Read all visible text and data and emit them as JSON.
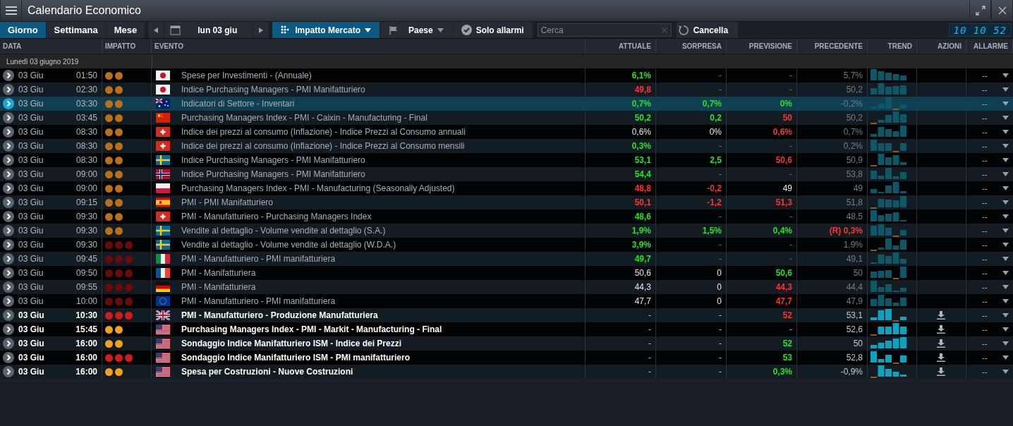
{
  "window": {
    "title": "Calendario Economico"
  },
  "tabs": [
    {
      "label": "Giorno",
      "selected": true
    },
    {
      "label": "Settimana",
      "selected": false
    },
    {
      "label": "Mese",
      "selected": false
    }
  ],
  "date_picker": {
    "value": "lun 03 giu"
  },
  "filters": [
    {
      "kind": "impact",
      "label": "Impatto Mercato",
      "active": true
    },
    {
      "kind": "country",
      "label": "Paese",
      "active": false
    },
    {
      "kind": "alarms",
      "label": "Solo allarmi",
      "active": false
    }
  ],
  "search": {
    "placeholder": "Cerca"
  },
  "reset_button": {
    "label": "Cancella"
  },
  "clock": "10 10 52",
  "columns": [
    "DATA",
    "IMPATTO",
    "EVENTO",
    "ATTUALE",
    "SORPRESA",
    "PREVISIONE",
    "PRECEDENTE",
    "TREND",
    "AZIONI",
    "ALLARME"
  ],
  "group": {
    "label": "Lunedì 03 giugno 2019"
  },
  "rows": [
    {
      "date": "03 Giu",
      "time": "01:50",
      "impact": [
        {
          "color": "#b8701a"
        },
        {
          "color": "#b8701a"
        }
      ],
      "released": true,
      "selected": false,
      "flag": {
        "kind": "jp"
      },
      "event": "Spese per Investimenti - (Annuale)",
      "actual": {
        "text": "6,1%",
        "color": "#22e622",
        "dimmed": false
      },
      "surprise": {
        "text": "-",
        "dimmed": true
      },
      "forecast": {
        "text": "-",
        "dimmed": true
      },
      "previous": {
        "text": "5,7%",
        "dimmed": true
      },
      "alarm": "--"
    },
    {
      "date": "03 Giu",
      "time": "02:30",
      "impact": [
        {
          "color": "#b8701a"
        },
        {
          "color": "#b8701a"
        }
      ],
      "released": true,
      "selected": false,
      "flag": {
        "kind": "jp"
      },
      "event": "Indice Purchasing Managers - PMI Manifatturiero",
      "actual": {
        "text": "49,8",
        "color": "#ff3333",
        "dimmed": false
      },
      "surprise": {
        "text": "-",
        "dimmed": true
      },
      "forecast": {
        "text": "-",
        "dimmed": true
      },
      "previous": {
        "text": "50,2",
        "dimmed": true
      },
      "alarm": "--"
    },
    {
      "date": "03 Giu",
      "time": "03:30",
      "impact": [
        {
          "color": "#b8701a"
        },
        {
          "color": "#b8701a"
        }
      ],
      "released": true,
      "selected": true,
      "flag": {
        "kind": "au"
      },
      "event": "Indicatori di Settore - Inventari",
      "actual": {
        "text": "0,7%",
        "color": "#22e622",
        "dimmed": false
      },
      "surprise": {
        "text": "0,7%",
        "color": "#22e622",
        "dimmed": false
      },
      "forecast": {
        "text": "0%",
        "color": "#22e622",
        "dimmed": false
      },
      "previous": {
        "text": "-0,2%",
        "dimmed": true
      },
      "alarm": "--"
    },
    {
      "date": "03 Giu",
      "time": "03:45",
      "impact": [
        {
          "color": "#b8701a"
        },
        {
          "color": "#b8701a"
        }
      ],
      "released": true,
      "selected": false,
      "flag": {
        "kind": "cn"
      },
      "event": "Purchasing Managers Index - PMI - Caixin - Manufacturing - Final",
      "actual": {
        "text": "50,2",
        "color": "#22e622",
        "dimmed": false
      },
      "surprise": {
        "text": "0,2",
        "color": "#22e622",
        "dimmed": false
      },
      "forecast": {
        "text": "50",
        "color": "#ff3333",
        "dimmed": false
      },
      "previous": {
        "text": "50,2",
        "dimmed": true
      },
      "alarm": "--"
    },
    {
      "date": "03 Giu",
      "time": "08:30",
      "impact": [
        {
          "color": "#b8701a"
        },
        {
          "color": "#b8701a"
        }
      ],
      "released": true,
      "selected": false,
      "flag": {
        "kind": "ch"
      },
      "event": "Indice dei prezzi al consumo (Inflazione) - Indice Prezzi al Consumo annuali",
      "actual": {
        "text": "0,6%",
        "dimmed": false
      },
      "surprise": {
        "text": "0%",
        "dimmed": false
      },
      "forecast": {
        "text": "0,6%",
        "color": "#ff3333",
        "dimmed": false
      },
      "previous": {
        "text": "0,7%",
        "dimmed": true
      },
      "alarm": "--"
    },
    {
      "date": "03 Giu",
      "time": "08:30",
      "impact": [
        {
          "color": "#b8701a"
        },
        {
          "color": "#b8701a"
        }
      ],
      "released": true,
      "selected": false,
      "flag": {
        "kind": "ch"
      },
      "event": "Indice dei prezzi al consumo (Inflazione) - Indice Prezzi al Consumo mensili",
      "actual": {
        "text": "0,3%",
        "color": "#22e622",
        "dimmed": false
      },
      "surprise": {
        "text": "-",
        "dimmed": true
      },
      "forecast": {
        "text": "-",
        "dimmed": true
      },
      "previous": {
        "text": "0,2%",
        "dimmed": true
      },
      "alarm": "--"
    },
    {
      "date": "03 Giu",
      "time": "08:30",
      "impact": [
        {
          "color": "#b8701a"
        },
        {
          "color": "#b8701a"
        }
      ],
      "released": true,
      "selected": false,
      "flag": {
        "kind": "se"
      },
      "event": "Indice Purchasing Managers - PMI Manifatturiero",
      "actual": {
        "text": "53,1",
        "color": "#22e622",
        "dimmed": false
      },
      "surprise": {
        "text": "2,5",
        "color": "#22e622",
        "dimmed": false
      },
      "forecast": {
        "text": "50,6",
        "color": "#ff3333",
        "dimmed": false
      },
      "previous": {
        "text": "50,9",
        "dimmed": true
      },
      "alarm": "--"
    },
    {
      "date": "03 Giu",
      "time": "09:00",
      "impact": [
        {
          "color": "#b8701a"
        },
        {
          "color": "#b8701a"
        }
      ],
      "released": true,
      "selected": false,
      "flag": {
        "kind": "no"
      },
      "event": "Indice Purchasing Managers - PMI Manifatturiero",
      "actual": {
        "text": "54,4",
        "color": "#22e622",
        "dimmed": false
      },
      "surprise": {
        "text": "-",
        "dimmed": true
      },
      "forecast": {
        "text": "-",
        "dimmed": true
      },
      "previous": {
        "text": "53,8",
        "dimmed": true
      },
      "alarm": "--"
    },
    {
      "date": "03 Giu",
      "time": "09:00",
      "impact": [
        {
          "color": "#b8701a"
        },
        {
          "color": "#b8701a"
        }
      ],
      "released": true,
      "selected": false,
      "flag": {
        "kind": "pl"
      },
      "event": "Purchasing Managers Index - PMI - Manufacturing (Seasonally Adjusted)",
      "actual": {
        "text": "48,8",
        "color": "#ff3333",
        "dimmed": false
      },
      "surprise": {
        "text": "-0,2",
        "color": "#ff3333",
        "dimmed": false
      },
      "forecast": {
        "text": "49",
        "dimmed": false
      },
      "previous": {
        "text": "49",
        "dimmed": true
      },
      "alarm": "--"
    },
    {
      "date": "03 Giu",
      "time": "09:15",
      "impact": [
        {
          "color": "#b8701a"
        },
        {
          "color": "#b8701a"
        }
      ],
      "released": true,
      "selected": false,
      "flag": {
        "kind": "es"
      },
      "event": "PMI - PMI Manifatturiero",
      "actual": {
        "text": "50,1",
        "color": "#ff3333",
        "dimmed": false
      },
      "surprise": {
        "text": "-1,2",
        "color": "#ff3333",
        "dimmed": false
      },
      "forecast": {
        "text": "51,3",
        "color": "#ff3333",
        "dimmed": false
      },
      "previous": {
        "text": "51,8",
        "dimmed": true
      },
      "alarm": "--"
    },
    {
      "date": "03 Giu",
      "time": "09:30",
      "impact": [
        {
          "color": "#b8701a"
        },
        {
          "color": "#b8701a"
        }
      ],
      "released": true,
      "selected": false,
      "flag": {
        "kind": "ch"
      },
      "event": "PMI - Manufatturiero - Purchasing Managers Index",
      "actual": {
        "text": "48,6",
        "color": "#22e622",
        "dimmed": false
      },
      "surprise": {
        "text": "-",
        "dimmed": true
      },
      "forecast": {
        "text": "-",
        "dimmed": true
      },
      "previous": {
        "text": "48,5",
        "dimmed": true
      },
      "alarm": "--"
    },
    {
      "date": "03 Giu",
      "time": "09:30",
      "impact": [
        {
          "color": "#b8701a"
        },
        {
          "color": "#b8701a"
        }
      ],
      "released": true,
      "selected": false,
      "flag": {
        "kind": "se"
      },
      "event": "Vendite al dettaglio - Volume vendite al dettaglio (S.A.)",
      "actual": {
        "text": "1,9%",
        "color": "#22e622",
        "dimmed": false
      },
      "surprise": {
        "text": "1,5%",
        "color": "#22e622",
        "dimmed": false
      },
      "forecast": {
        "text": "0,4%",
        "color": "#22e622",
        "dimmed": false
      },
      "previous": {
        "text": "(R) 0,3%",
        "color": "#ff3333",
        "dimmed": false
      },
      "alarm": "--"
    },
    {
      "date": "03 Giu",
      "time": "09:30",
      "impact": [
        {
          "color": "#6a0c0c"
        },
        {
          "color": "#6a0c0c"
        },
        {
          "color": "#6a0c0c"
        }
      ],
      "released": true,
      "selected": false,
      "flag": {
        "kind": "se"
      },
      "event": "Vendite al dettaglio - Volume vendite al dettaglio (W.D.A.)",
      "actual": {
        "text": "3,9%",
        "color": "#22e622",
        "dimmed": false
      },
      "surprise": {
        "text": "-",
        "dimmed": true
      },
      "forecast": {
        "text": "-",
        "dimmed": true
      },
      "previous": {
        "text": "1,9%",
        "dimmed": true
      },
      "alarm": "--"
    },
    {
      "date": "03 Giu",
      "time": "09:45",
      "impact": [
        {
          "color": "#6a0c0c"
        },
        {
          "color": "#6a0c0c"
        },
        {
          "color": "#6a0c0c"
        }
      ],
      "released": true,
      "selected": false,
      "flag": {
        "kind": "it"
      },
      "event": "PMI - Manufatturiero - PMI manifatturiera",
      "actual": {
        "text": "49,7",
        "color": "#22e622",
        "dimmed": false
      },
      "surprise": {
        "text": "-",
        "dimmed": true
      },
      "forecast": {
        "text": "-",
        "dimmed": true
      },
      "previous": {
        "text": "49,1",
        "dimmed": true
      },
      "alarm": "--"
    },
    {
      "date": "03 Giu",
      "time": "09:50",
      "impact": [
        {
          "color": "#6a0c0c"
        },
        {
          "color": "#6a0c0c"
        },
        {
          "color": "#6a0c0c"
        }
      ],
      "released": true,
      "selected": false,
      "flag": {
        "kind": "fr"
      },
      "event": "PMI - Manifatturiera",
      "actual": {
        "text": "50,6",
        "dimmed": false
      },
      "surprise": {
        "text": "0",
        "dimmed": false
      },
      "forecast": {
        "text": "50,6",
        "color": "#22e622",
        "dimmed": false
      },
      "previous": {
        "text": "50",
        "dimmed": true
      },
      "alarm": "--"
    },
    {
      "date": "03 Giu",
      "time": "09:55",
      "impact": [
        {
          "color": "#6a0c0c"
        },
        {
          "color": "#6a0c0c"
        },
        {
          "color": "#6a0c0c"
        }
      ],
      "released": true,
      "selected": false,
      "flag": {
        "kind": "de"
      },
      "event": "PMI - Manifatturiera",
      "actual": {
        "text": "44,3",
        "dimmed": false
      },
      "surprise": {
        "text": "0",
        "dimmed": false
      },
      "forecast": {
        "text": "44,3",
        "color": "#ff3333",
        "dimmed": false
      },
      "previous": {
        "text": "44,4",
        "dimmed": true
      },
      "alarm": "--"
    },
    {
      "date": "03 Giu",
      "time": "10:00",
      "impact": [
        {
          "color": "#6a0c0c"
        },
        {
          "color": "#6a0c0c"
        },
        {
          "color": "#6a0c0c"
        }
      ],
      "released": true,
      "selected": false,
      "flag": {
        "kind": "eu"
      },
      "event": "PMI - Manufatturiero - PMI manifatturiera",
      "actual": {
        "text": "47,7",
        "dimmed": false
      },
      "surprise": {
        "text": "0",
        "dimmed": false
      },
      "forecast": {
        "text": "47,7",
        "color": "#ff3333",
        "dimmed": false
      },
      "previous": {
        "text": "47,9",
        "dimmed": true
      },
      "alarm": "--"
    },
    {
      "date": "03 Giu",
      "time": "10:30",
      "impact": [
        {
          "color": "#d01c1c"
        },
        {
          "color": "#d01c1c"
        },
        {
          "color": "#d01c1c"
        }
      ],
      "released": false,
      "selected": false,
      "flag": {
        "kind": "gb"
      },
      "event": "PMI - Manufatturiero - Produzione Manufatturiera",
      "actual": {
        "text": "-",
        "dimmed": true
      },
      "surprise": {
        "text": "-",
        "dimmed": true
      },
      "forecast": {
        "text": "52",
        "color": "#ff3333",
        "dimmed": false
      },
      "previous": {
        "text": "53,1",
        "dimmed": true
      },
      "alarm": "--"
    },
    {
      "date": "03 Giu",
      "time": "15:45",
      "impact": [
        {
          "color": "#f2a020"
        },
        {
          "color": "#f2a020"
        }
      ],
      "released": false,
      "selected": false,
      "flag": {
        "kind": "us"
      },
      "event": "Purchasing Managers Index - PMI - Markit - Manufacturing - Final",
      "actual": {
        "text": "-",
        "dimmed": true
      },
      "surprise": {
        "text": "-",
        "dimmed": true
      },
      "forecast": {
        "text": "-",
        "dimmed": true
      },
      "previous": {
        "text": "52,6",
        "dimmed": true
      },
      "alarm": "--"
    },
    {
      "date": "03 Giu",
      "time": "16:00",
      "impact": [
        {
          "color": "#f2a020"
        },
        {
          "color": "#f2a020"
        }
      ],
      "released": false,
      "selected": false,
      "flag": {
        "kind": "us"
      },
      "event": "Sondaggio Indice Manifatturiero ISM - Indice dei Prezzi",
      "actual": {
        "text": "-",
        "dimmed": true
      },
      "surprise": {
        "text": "-",
        "dimmed": true
      },
      "forecast": {
        "text": "52",
        "color": "#22e622",
        "dimmed": false
      },
      "previous": {
        "text": "50",
        "dimmed": true
      },
      "alarm": "--"
    },
    {
      "date": "03 Giu",
      "time": "16:00",
      "impact": [
        {
          "color": "#d01c1c"
        },
        {
          "color": "#d01c1c"
        },
        {
          "color": "#d01c1c"
        }
      ],
      "released": false,
      "selected": false,
      "flag": {
        "kind": "us"
      },
      "event": "Sondaggio Indice Manifatturiero ISM - PMI manifatturiero",
      "actual": {
        "text": "-",
        "dimmed": true
      },
      "surprise": {
        "text": "-",
        "dimmed": true
      },
      "forecast": {
        "text": "53",
        "color": "#22e622",
        "dimmed": false
      },
      "previous": {
        "text": "52,8",
        "dimmed": true
      },
      "alarm": "--"
    },
    {
      "date": "03 Giu",
      "time": "16:00",
      "impact": [
        {
          "color": "#f2a020"
        },
        {
          "color": "#f2a020"
        }
      ],
      "released": false,
      "selected": false,
      "flag": {
        "kind": "us"
      },
      "event": "Spesa per Costruzioni - Nuove Costruzioni",
      "actual": {
        "text": "-",
        "dimmed": true
      },
      "surprise": {
        "text": "-",
        "dimmed": true
      },
      "forecast": {
        "text": "0,3%",
        "color": "#22e622",
        "dimmed": false
      },
      "previous": {
        "text": "-0,9%",
        "dimmed": true
      },
      "alarm": "--"
    }
  ]
}
